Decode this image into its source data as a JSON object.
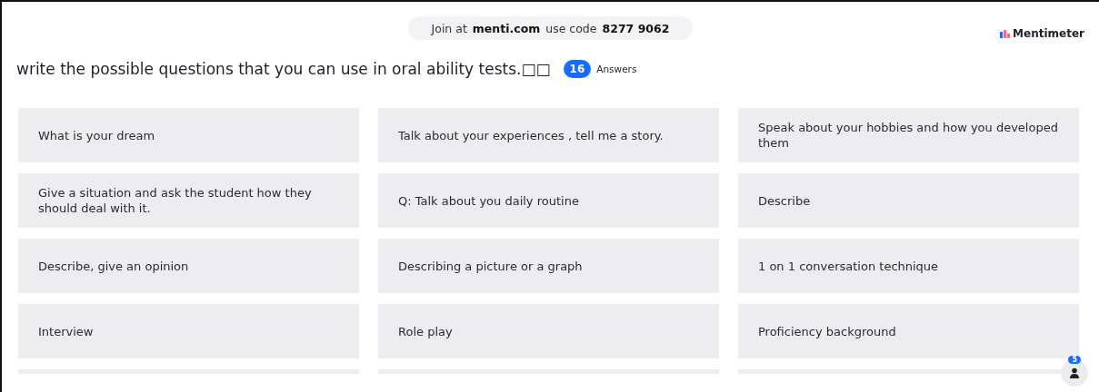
{
  "join_bar": {
    "prefix": "Join at",
    "site": "menti.com",
    "middle": "use code",
    "code": "8277 9062"
  },
  "brand": "Mentimeter",
  "question": "write the possible questions that you can use in oral ability tests.□□",
  "answer_count": "16",
  "answer_label": "Answers",
  "cards": [
    {
      "text": "What is your dream"
    },
    {
      "text": "Talk about your experiences , tell me a story."
    },
    {
      "text": "Speak about your hobbies and how you developed them"
    },
    {
      "text": "Give a situation and ask the student how they should deal with it."
    },
    {
      "text": "Q: Talk about you daily routine"
    },
    {
      "text": "Describe"
    },
    {
      "text": "Describe, give an opinion"
    },
    {
      "text": "Describing a picture or a graph"
    },
    {
      "text": "1 on 1 conversation technique"
    },
    {
      "text": "Interview"
    },
    {
      "text": "Role play"
    },
    {
      "text": "Proficiency background"
    }
  ],
  "clipped_cards": [
    {
      "kind": "clipped"
    },
    {
      "kind": "clipped"
    },
    {
      "kind": "clipped"
    }
  ],
  "participants": {
    "count": "5"
  }
}
